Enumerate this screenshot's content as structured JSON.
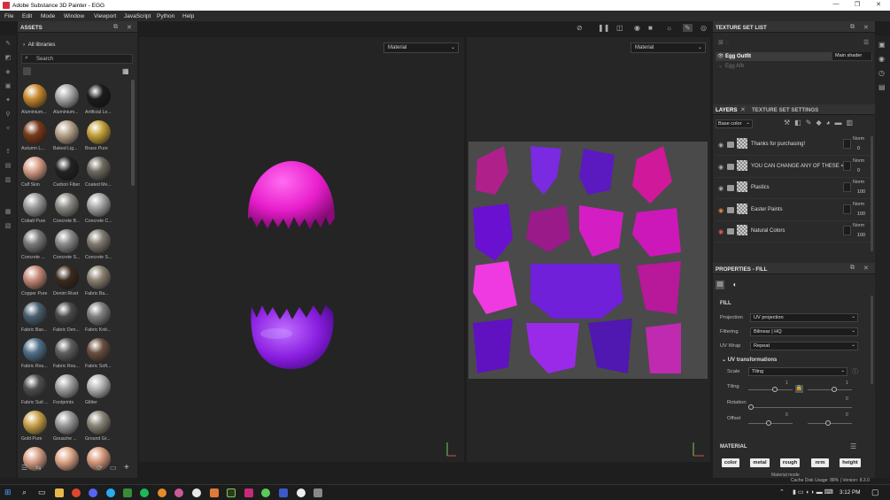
{
  "window": {
    "title": "Adobe Substance 3D Painter - EGG"
  },
  "menu": [
    "File",
    "Edit",
    "Mode",
    "Window",
    "Viewport",
    "JavaScript",
    "Python",
    "Help"
  ],
  "assets": {
    "title": "ASSETS",
    "library": "All libraries",
    "search_placeholder": "Search",
    "materials": [
      {
        "label": "Aluminium...",
        "color": "#c88a2e"
      },
      {
        "label": "Aluminium...",
        "color": "#a9a9a9"
      },
      {
        "label": "Artificial Le...",
        "color": "#1b1b1b"
      },
      {
        "label": "Autumn L...",
        "color": "#7a3a1a"
      },
      {
        "label": "Baked Lig...",
        "color": "#b5a38a"
      },
      {
        "label": "Brass Pure",
        "color": "#c4a23a"
      },
      {
        "label": "Calf Skin",
        "color": "#d9a089"
      },
      {
        "label": "Carbon Fiber",
        "color": "#222222"
      },
      {
        "label": "Coated Me...",
        "color": "#6e6a60"
      },
      {
        "label": "Cobalt Pure",
        "color": "#9a9a9a"
      },
      {
        "label": "Concrete B...",
        "color": "#8d8a84"
      },
      {
        "label": "Concrete C...",
        "color": "#a6a6a6"
      },
      {
        "label": "Concrete ...",
        "color": "#7a7a7a"
      },
      {
        "label": "Concrete S...",
        "color": "#8a8a8a"
      },
      {
        "label": "Concrete S...",
        "color": "#807a70"
      },
      {
        "label": "Copper Pure",
        "color": "#c58a78"
      },
      {
        "label": "Denim Rivet",
        "color": "#3a2a1e"
      },
      {
        "label": "Fabric Ba...",
        "color": "#8a8070"
      },
      {
        "label": "Fabric Bas...",
        "color": "#4a6070"
      },
      {
        "label": "Fabric Den...",
        "color": "#4a4a4a"
      },
      {
        "label": "Fabric Knit...",
        "color": "#7e7e7e"
      },
      {
        "label": "Fabric Rou...",
        "color": "#50708a"
      },
      {
        "label": "Fabric Rou...",
        "color": "#5e5e5e"
      },
      {
        "label": "Fabric Soft...",
        "color": "#6a4e40"
      },
      {
        "label": "Fabric Suit ...",
        "color": "#4e4e4e"
      },
      {
        "label": "Footprints",
        "color": "#a0a0a0"
      },
      {
        "label": "Glitter",
        "color": "#b4b4b4"
      },
      {
        "label": "Gold Pure",
        "color": "#c9a24a"
      },
      {
        "label": "Gouache ...",
        "color": "#9a9a9a"
      },
      {
        "label": "Ground Gr...",
        "color": "#8a8578"
      },
      {
        "label": "",
        "color": "#d9a089"
      },
      {
        "label": "",
        "color": "#e0a88a"
      },
      {
        "label": "",
        "color": "#d99a7c"
      }
    ]
  },
  "viewport": {
    "left_mode": "Material",
    "right_mode": "Material"
  },
  "texture_set_list": {
    "title": "TEXTURE SET LIST",
    "items": [
      {
        "name": "Egg Outfit",
        "shader": "Main shader"
      },
      {
        "name": "Egg Afb",
        "shader": ""
      }
    ]
  },
  "layers": {
    "tab_layers": "LAYERS",
    "tab_settings": "TEXTURE SET SETTINGS",
    "channel": "Base color",
    "items": [
      {
        "name": "Thanks for purchasing!",
        "blend": "Norm",
        "opacity": "0",
        "eye": "#aaaaaa"
      },
      {
        "name": "YOU CAN CHANGE ANY OF THESE <3",
        "blend": "Norm",
        "opacity": "0",
        "eye": "#aaaaaa"
      },
      {
        "name": "Plastics",
        "blend": "Norm",
        "opacity": "100",
        "eye": "#aaaaaa"
      },
      {
        "name": "Easter Paints",
        "blend": "Norm",
        "opacity": "100",
        "eye": "#e08a4a"
      },
      {
        "name": "Natural Colors",
        "blend": "Norm",
        "opacity": "100",
        "eye": "#e05a5a"
      }
    ]
  },
  "properties": {
    "title": "PROPERTIES - FILL",
    "section": "FILL",
    "projection_label": "Projection",
    "projection": "UV projection",
    "filtering_label": "Filtering",
    "filtering": "Bilinear | HQ",
    "uvwrap_label": "UV Wrap",
    "uvwrap": "Repeat",
    "uvtrans": "UV transformations",
    "scale_label": "Scale",
    "scale": "Tiling",
    "tiling_label": "Tiling",
    "tiling_a": "1",
    "tiling_b": "1",
    "rotation_label": "Rotation",
    "rotation": "0",
    "offset_label": "Offset",
    "offset_a": "0",
    "offset_b": "0",
    "material_section": "MATERIAL",
    "material_chips": [
      "color",
      "metal",
      "rough",
      "nrm",
      "height"
    ],
    "material_mode": "Material mode"
  },
  "status": {
    "cache": "Cache Disk Usage:",
    "cache_pct": "88%",
    "version": "Version: 8.3.0"
  },
  "taskbar": {
    "time": "3:12 PM"
  }
}
